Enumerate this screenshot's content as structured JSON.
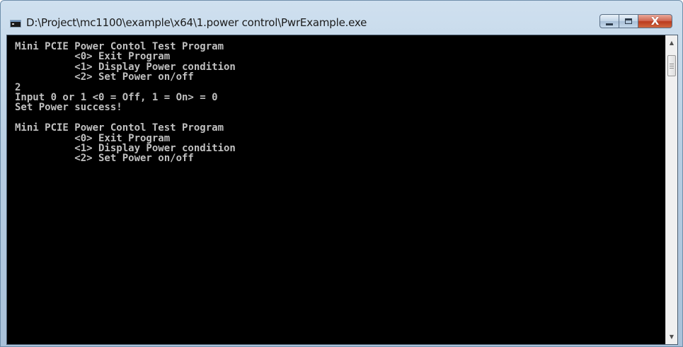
{
  "window": {
    "title": "D:\\Project\\mc1100\\example\\x64\\1.power control\\PwrExample.exe"
  },
  "caption_buttons": {
    "close_glyph": "X"
  },
  "console": {
    "lines": [
      "Mini PCIE Power Contol Test Program",
      "          <0> Exit Program",
      "          <1> Display Power condition",
      "          <2> Set Power on/off",
      "2",
      "Input 0 or 1 <0 = Off, 1 = On> = 0",
      "Set Power success!",
      "",
      "Mini PCIE Power Contol Test Program",
      "          <0> Exit Program",
      "          <1> Display Power condition",
      "          <2> Set Power on/off"
    ]
  },
  "scrollbar": {
    "up_arrow": "▲",
    "down_arrow": "▼"
  },
  "colors": {
    "console_background": "#000000",
    "console_text": "#c0c0c0",
    "close_button": "#c9462b"
  },
  "icons": [
    "console-app-icon",
    "minimize-icon",
    "maximize-icon",
    "close-icon",
    "scroll-up-arrow-icon",
    "scroll-down-arrow-icon"
  ]
}
